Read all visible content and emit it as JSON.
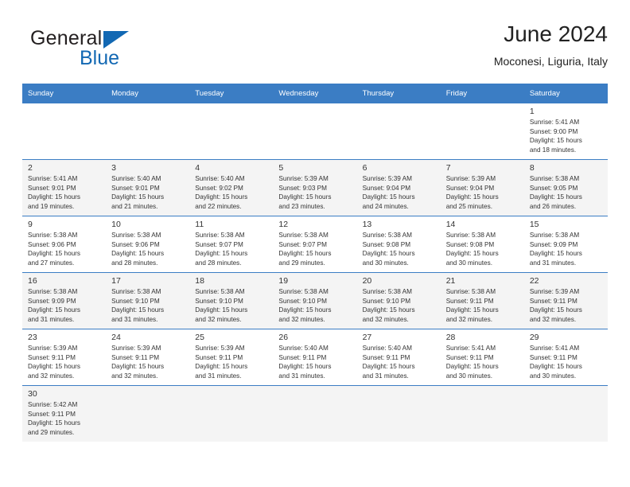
{
  "brand": {
    "name_top": "General",
    "name_bottom": "Blue",
    "accent_color": "#1268b3",
    "logo_icon": "blue-triangle-flag-icon"
  },
  "header": {
    "title": "June 2024",
    "subtitle": "Moconesi, Liguria, Italy"
  },
  "theme": {
    "header_row_bg": "#3b7dc4",
    "shaded_row_bg": "#f4f4f4",
    "grid_line": "#3b7dc4",
    "text": "#333333"
  },
  "labels": {
    "sunrise_prefix": "Sunrise:",
    "sunset_prefix": "Sunset:",
    "daylight_prefix": "Daylight:"
  },
  "weekdays": [
    "Sunday",
    "Monday",
    "Tuesday",
    "Wednesday",
    "Thursday",
    "Friday",
    "Saturday"
  ],
  "weeks": [
    {
      "shaded": false,
      "days": [
        null,
        null,
        null,
        null,
        null,
        null,
        {
          "day": "1",
          "sunrise": "Sunrise: 5:41 AM",
          "sunset": "Sunset: 9:00 PM",
          "daylight_line1": "Daylight: 15 hours",
          "daylight_line2": "and 18 minutes."
        }
      ]
    },
    {
      "shaded": true,
      "days": [
        {
          "day": "2",
          "sunrise": "Sunrise: 5:41 AM",
          "sunset": "Sunset: 9:01 PM",
          "daylight_line1": "Daylight: 15 hours",
          "daylight_line2": "and 19 minutes."
        },
        {
          "day": "3",
          "sunrise": "Sunrise: 5:40 AM",
          "sunset": "Sunset: 9:01 PM",
          "daylight_line1": "Daylight: 15 hours",
          "daylight_line2": "and 21 minutes."
        },
        {
          "day": "4",
          "sunrise": "Sunrise: 5:40 AM",
          "sunset": "Sunset: 9:02 PM",
          "daylight_line1": "Daylight: 15 hours",
          "daylight_line2": "and 22 minutes."
        },
        {
          "day": "5",
          "sunrise": "Sunrise: 5:39 AM",
          "sunset": "Sunset: 9:03 PM",
          "daylight_line1": "Daylight: 15 hours",
          "daylight_line2": "and 23 minutes."
        },
        {
          "day": "6",
          "sunrise": "Sunrise: 5:39 AM",
          "sunset": "Sunset: 9:04 PM",
          "daylight_line1": "Daylight: 15 hours",
          "daylight_line2": "and 24 minutes."
        },
        {
          "day": "7",
          "sunrise": "Sunrise: 5:39 AM",
          "sunset": "Sunset: 9:04 PM",
          "daylight_line1": "Daylight: 15 hours",
          "daylight_line2": "and 25 minutes."
        },
        {
          "day": "8",
          "sunrise": "Sunrise: 5:38 AM",
          "sunset": "Sunset: 9:05 PM",
          "daylight_line1": "Daylight: 15 hours",
          "daylight_line2": "and 26 minutes."
        }
      ]
    },
    {
      "shaded": false,
      "days": [
        {
          "day": "9",
          "sunrise": "Sunrise: 5:38 AM",
          "sunset": "Sunset: 9:06 PM",
          "daylight_line1": "Daylight: 15 hours",
          "daylight_line2": "and 27 minutes."
        },
        {
          "day": "10",
          "sunrise": "Sunrise: 5:38 AM",
          "sunset": "Sunset: 9:06 PM",
          "daylight_line1": "Daylight: 15 hours",
          "daylight_line2": "and 28 minutes."
        },
        {
          "day": "11",
          "sunrise": "Sunrise: 5:38 AM",
          "sunset": "Sunset: 9:07 PM",
          "daylight_line1": "Daylight: 15 hours",
          "daylight_line2": "and 28 minutes."
        },
        {
          "day": "12",
          "sunrise": "Sunrise: 5:38 AM",
          "sunset": "Sunset: 9:07 PM",
          "daylight_line1": "Daylight: 15 hours",
          "daylight_line2": "and 29 minutes."
        },
        {
          "day": "13",
          "sunrise": "Sunrise: 5:38 AM",
          "sunset": "Sunset: 9:08 PM",
          "daylight_line1": "Daylight: 15 hours",
          "daylight_line2": "and 30 minutes."
        },
        {
          "day": "14",
          "sunrise": "Sunrise: 5:38 AM",
          "sunset": "Sunset: 9:08 PM",
          "daylight_line1": "Daylight: 15 hours",
          "daylight_line2": "and 30 minutes."
        },
        {
          "day": "15",
          "sunrise": "Sunrise: 5:38 AM",
          "sunset": "Sunset: 9:09 PM",
          "daylight_line1": "Daylight: 15 hours",
          "daylight_line2": "and 31 minutes."
        }
      ]
    },
    {
      "shaded": true,
      "days": [
        {
          "day": "16",
          "sunrise": "Sunrise: 5:38 AM",
          "sunset": "Sunset: 9:09 PM",
          "daylight_line1": "Daylight: 15 hours",
          "daylight_line2": "and 31 minutes."
        },
        {
          "day": "17",
          "sunrise": "Sunrise: 5:38 AM",
          "sunset": "Sunset: 9:10 PM",
          "daylight_line1": "Daylight: 15 hours",
          "daylight_line2": "and 31 minutes."
        },
        {
          "day": "18",
          "sunrise": "Sunrise: 5:38 AM",
          "sunset": "Sunset: 9:10 PM",
          "daylight_line1": "Daylight: 15 hours",
          "daylight_line2": "and 32 minutes."
        },
        {
          "day": "19",
          "sunrise": "Sunrise: 5:38 AM",
          "sunset": "Sunset: 9:10 PM",
          "daylight_line1": "Daylight: 15 hours",
          "daylight_line2": "and 32 minutes."
        },
        {
          "day": "20",
          "sunrise": "Sunrise: 5:38 AM",
          "sunset": "Sunset: 9:10 PM",
          "daylight_line1": "Daylight: 15 hours",
          "daylight_line2": "and 32 minutes."
        },
        {
          "day": "21",
          "sunrise": "Sunrise: 5:38 AM",
          "sunset": "Sunset: 9:11 PM",
          "daylight_line1": "Daylight: 15 hours",
          "daylight_line2": "and 32 minutes."
        },
        {
          "day": "22",
          "sunrise": "Sunrise: 5:39 AM",
          "sunset": "Sunset: 9:11 PM",
          "daylight_line1": "Daylight: 15 hours",
          "daylight_line2": "and 32 minutes."
        }
      ]
    },
    {
      "shaded": false,
      "days": [
        {
          "day": "23",
          "sunrise": "Sunrise: 5:39 AM",
          "sunset": "Sunset: 9:11 PM",
          "daylight_line1": "Daylight: 15 hours",
          "daylight_line2": "and 32 minutes."
        },
        {
          "day": "24",
          "sunrise": "Sunrise: 5:39 AM",
          "sunset": "Sunset: 9:11 PM",
          "daylight_line1": "Daylight: 15 hours",
          "daylight_line2": "and 32 minutes."
        },
        {
          "day": "25",
          "sunrise": "Sunrise: 5:39 AM",
          "sunset": "Sunset: 9:11 PM",
          "daylight_line1": "Daylight: 15 hours",
          "daylight_line2": "and 31 minutes."
        },
        {
          "day": "26",
          "sunrise": "Sunrise: 5:40 AM",
          "sunset": "Sunset: 9:11 PM",
          "daylight_line1": "Daylight: 15 hours",
          "daylight_line2": "and 31 minutes."
        },
        {
          "day": "27",
          "sunrise": "Sunrise: 5:40 AM",
          "sunset": "Sunset: 9:11 PM",
          "daylight_line1": "Daylight: 15 hours",
          "daylight_line2": "and 31 minutes."
        },
        {
          "day": "28",
          "sunrise": "Sunrise: 5:41 AM",
          "sunset": "Sunset: 9:11 PM",
          "daylight_line1": "Daylight: 15 hours",
          "daylight_line2": "and 30 minutes."
        },
        {
          "day": "29",
          "sunrise": "Sunrise: 5:41 AM",
          "sunset": "Sunset: 9:11 PM",
          "daylight_line1": "Daylight: 15 hours",
          "daylight_line2": "and 30 minutes."
        }
      ]
    },
    {
      "shaded": true,
      "days": [
        {
          "day": "30",
          "sunrise": "Sunrise: 5:42 AM",
          "sunset": "Sunset: 9:11 PM",
          "daylight_line1": "Daylight: 15 hours",
          "daylight_line2": "and 29 minutes."
        },
        null,
        null,
        null,
        null,
        null,
        null
      ]
    }
  ]
}
